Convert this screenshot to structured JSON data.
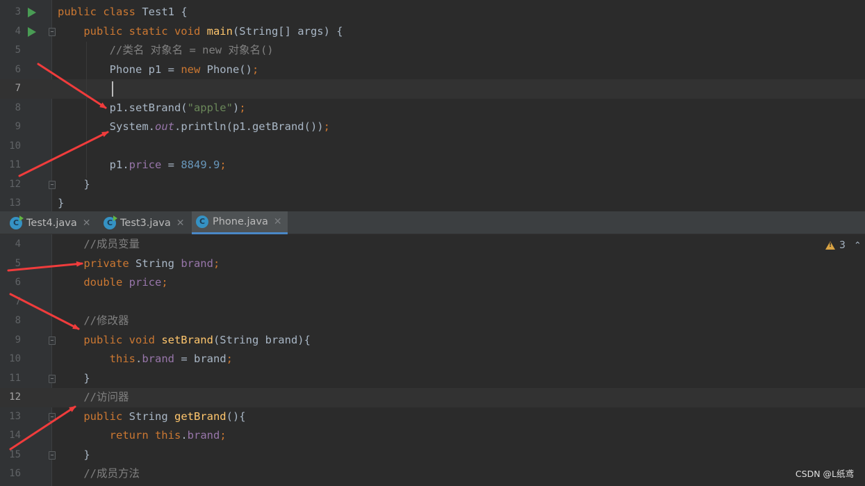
{
  "editor_top": {
    "lines": [
      {
        "num": "3",
        "run_icon": true,
        "fold_icon": false,
        "current": false,
        "tokens": [
          {
            "t": "public class ",
            "c": "kw"
          },
          {
            "t": "Test1 {",
            "c": "plain"
          }
        ]
      },
      {
        "num": "4",
        "run_icon": true,
        "fold_icon": true,
        "current": false,
        "tokens": [
          {
            "t": "    "
          },
          {
            "t": "public static void ",
            "c": "kw"
          },
          {
            "t": "main",
            "c": "fn"
          },
          {
            "t": "(String[] args) {",
            "c": "plain"
          }
        ]
      },
      {
        "num": "5",
        "current": false,
        "tokens": [
          {
            "t": "        "
          },
          {
            "t": "//类名 对象名 = new 对象名()",
            "c": "cmt"
          }
        ]
      },
      {
        "num": "6",
        "current": false,
        "tokens": [
          {
            "t": "        Phone p1 = ",
            "c": "plain"
          },
          {
            "t": "new ",
            "c": "kw"
          },
          {
            "t": "Phone()",
            "c": "plain"
          },
          {
            "t": ";",
            "c": "kw"
          }
        ]
      },
      {
        "num": "7",
        "current": true,
        "caret": true,
        "tokens": []
      },
      {
        "num": "8",
        "current": false,
        "tokens": [
          {
            "t": "        p1.setBrand(",
            "c": "plain"
          },
          {
            "t": "\"apple\"",
            "c": "str"
          },
          {
            "t": ")",
            "c": "plain"
          },
          {
            "t": ";",
            "c": "kw"
          }
        ]
      },
      {
        "num": "9",
        "current": false,
        "tokens": [
          {
            "t": "        System.",
            "c": "plain"
          },
          {
            "t": "out",
            "c": "sfld"
          },
          {
            "t": ".println(p1.getBrand())",
            "c": "plain"
          },
          {
            "t": ";",
            "c": "kw"
          }
        ]
      },
      {
        "num": "10",
        "current": false,
        "tokens": []
      },
      {
        "num": "11",
        "current": false,
        "tokens": [
          {
            "t": "        p1.",
            "c": "plain"
          },
          {
            "t": "price",
            "c": "fld"
          },
          {
            "t": " = ",
            "c": "plain"
          },
          {
            "t": "8849.9",
            "c": "num"
          },
          {
            "t": ";",
            "c": "kw"
          }
        ]
      },
      {
        "num": "12",
        "fold_icon": true,
        "current": false,
        "tokens": [
          {
            "t": "    }",
            "c": "plain"
          }
        ]
      },
      {
        "num": "13",
        "current": false,
        "tokens": [
          {
            "t": "}",
            "c": "plain"
          }
        ]
      }
    ]
  },
  "tabs": [
    {
      "label": "Test4.java",
      "icon": "java-class-runnable-icon",
      "active": false,
      "close": "✕"
    },
    {
      "label": "Test3.java",
      "icon": "java-class-runnable-icon",
      "active": false,
      "close": "✕"
    },
    {
      "label": "Phone.java",
      "icon": "java-class-icon",
      "active": true,
      "close": "✕"
    }
  ],
  "tab_icon_letter": "C",
  "inspection": {
    "icon": "warning-icon",
    "count": "3",
    "chevron": "⌃"
  },
  "editor_bottom": {
    "lines": [
      {
        "num": "4",
        "current": false,
        "tokens": [
          {
            "t": "    "
          },
          {
            "t": "//成员变量",
            "c": "cmt"
          }
        ]
      },
      {
        "num": "5",
        "current": false,
        "tokens": [
          {
            "t": "    "
          },
          {
            "t": "private ",
            "c": "kw"
          },
          {
            "t": "String ",
            "c": "plain"
          },
          {
            "t": "brand",
            "c": "fld"
          },
          {
            "t": ";",
            "c": "kw"
          }
        ]
      },
      {
        "num": "6",
        "current": false,
        "tokens": [
          {
            "t": "    "
          },
          {
            "t": "double ",
            "c": "kw"
          },
          {
            "t": "price",
            "c": "fld"
          },
          {
            "t": ";",
            "c": "kw"
          }
        ]
      },
      {
        "num": "7",
        "current": false,
        "tokens": []
      },
      {
        "num": "8",
        "current": false,
        "tokens": [
          {
            "t": "    "
          },
          {
            "t": "//修改器",
            "c": "cmt"
          }
        ]
      },
      {
        "num": "9",
        "fold_icon": true,
        "current": false,
        "tokens": [
          {
            "t": "    "
          },
          {
            "t": "public void ",
            "c": "kw"
          },
          {
            "t": "setBrand",
            "c": "fn"
          },
          {
            "t": "(String brand){",
            "c": "plain"
          }
        ]
      },
      {
        "num": "10",
        "current": false,
        "tokens": [
          {
            "t": "        "
          },
          {
            "t": "this",
            "c": "kw"
          },
          {
            "t": ".",
            "c": "plain"
          },
          {
            "t": "brand",
            "c": "fld"
          },
          {
            "t": " = brand",
            "c": "plain"
          },
          {
            "t": ";",
            "c": "kw"
          }
        ]
      },
      {
        "num": "11",
        "fold_icon": true,
        "current": false,
        "tokens": [
          {
            "t": "    }",
            "c": "plain"
          }
        ]
      },
      {
        "num": "12",
        "current": true,
        "tokens": [
          {
            "t": "    "
          },
          {
            "t": "//访问器",
            "c": "cmt"
          }
        ]
      },
      {
        "num": "13",
        "fold_icon": true,
        "current": false,
        "tokens": [
          {
            "t": "    "
          },
          {
            "t": "public ",
            "c": "kw"
          },
          {
            "t": "String ",
            "c": "plain"
          },
          {
            "t": "getBrand",
            "c": "fn"
          },
          {
            "t": "(){",
            "c": "plain"
          }
        ]
      },
      {
        "num": "14",
        "current": false,
        "tokens": [
          {
            "t": "        "
          },
          {
            "t": "return this",
            "c": "kw"
          },
          {
            "t": ".",
            "c": "plain"
          },
          {
            "t": "brand",
            "c": "fld"
          },
          {
            "t": ";",
            "c": "kw"
          }
        ]
      },
      {
        "num": "15",
        "fold_icon": true,
        "current": false,
        "tokens": [
          {
            "t": "    }",
            "c": "plain"
          }
        ]
      },
      {
        "num": "16",
        "current": false,
        "tokens": [
          {
            "t": "    "
          },
          {
            "t": "//成员方法",
            "c": "cmt"
          }
        ]
      }
    ]
  },
  "annotation_color": "#f03c3c",
  "watermark": "CSDN @L纸鸢"
}
